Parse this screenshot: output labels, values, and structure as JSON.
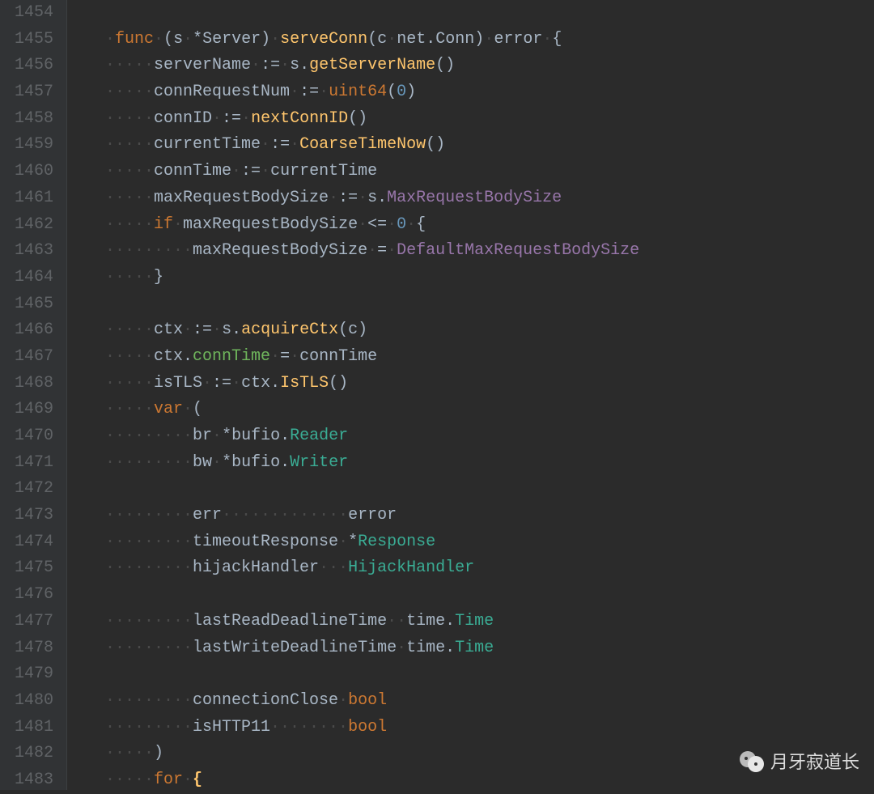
{
  "line_numbers": [
    1454,
    1455,
    1456,
    1457,
    1458,
    1459,
    1460,
    1461,
    1462,
    1463,
    1464,
    1465,
    1466,
    1467,
    1468,
    1469,
    1470,
    1471,
    1472,
    1473,
    1474,
    1475,
    1476,
    1477,
    1478,
    1479,
    1480,
    1481,
    1482,
    1483
  ],
  "colors": {
    "background": "#2b2b2b",
    "gutter": "#313335",
    "gutter_text": "#606366",
    "keyword": "#cc7832",
    "function": "#ffc66d",
    "variable": "#9876aa",
    "type": "#3aac94",
    "number": "#6897bb",
    "default": "#a9b7c6"
  },
  "watermark": {
    "text": "月牙寂道长",
    "icon": "wechat-icon"
  },
  "code": {
    "l1454": "",
    "l1455": {
      "func": "func",
      "recv_s": "s",
      "recv_ty": "Server",
      "name": "serveConn",
      "arg": "c",
      "arg_ty_pkg": "net",
      "arg_ty": "Conn",
      "ret": "error"
    },
    "l1456": {
      "lhs": "serverName",
      "assign": ":=",
      "recv": "s",
      "call": "getServerName"
    },
    "l1457": {
      "lhs": "connRequestNum",
      "assign": ":=",
      "call": "uint64",
      "arg": "0"
    },
    "l1458": {
      "lhs": "connID",
      "assign": ":=",
      "call": "nextConnID"
    },
    "l1459": {
      "lhs": "currentTime",
      "assign": ":=",
      "call": "CoarseTimeNow"
    },
    "l1460": {
      "lhs": "connTime",
      "assign": ":=",
      "rhs": "currentTime"
    },
    "l1461": {
      "lhs": "maxRequestBodySize",
      "assign": ":=",
      "recv": "s",
      "field": "MaxRequestBodySize"
    },
    "l1462": {
      "kw": "if",
      "lhs": "maxRequestBodySize",
      "op": "<=",
      "rhs": "0"
    },
    "l1463": {
      "lhs": "maxRequestBodySize",
      "assign": "=",
      "rhs": "DefaultMaxRequestBodySize"
    },
    "l1464": {
      "brace": "}"
    },
    "l1465": "",
    "l1466": {
      "lhs": "ctx",
      "assign": ":=",
      "recv": "s",
      "call": "acquireCtx",
      "arg": "c"
    },
    "l1467": {
      "lhs": "ctx",
      "field": "connTime",
      "assign": "=",
      "rhs": "connTime"
    },
    "l1468": {
      "lhs": "isTLS",
      "assign": ":=",
      "recv": "ctx",
      "call": "IsTLS"
    },
    "l1469": {
      "kw": "var",
      "paren": "("
    },
    "l1470": {
      "name": "br",
      "star": "*",
      "pkg": "bufio",
      "ty": "Reader"
    },
    "l1471": {
      "name": "bw",
      "star": "*",
      "pkg": "bufio",
      "ty": "Writer"
    },
    "l1472": "",
    "l1473": {
      "name": "err",
      "ty": "error"
    },
    "l1474": {
      "name": "timeoutResponse",
      "star": "*",
      "ty": "Response"
    },
    "l1475": {
      "name": "hijackHandler",
      "ty": "HijackHandler"
    },
    "l1476": "",
    "l1477": {
      "name": "lastReadDeadlineTime",
      "pkg": "time",
      "ty": "Time"
    },
    "l1478": {
      "name": "lastWriteDeadlineTime",
      "pkg": "time",
      "ty": "Time"
    },
    "l1479": "",
    "l1480": {
      "name": "connectionClose",
      "ty": "bool"
    },
    "l1481": {
      "name": "isHTTP11",
      "ty": "bool"
    },
    "l1482": {
      "paren": ")"
    },
    "l1483": {
      "kw": "for",
      "brace": "{"
    }
  }
}
